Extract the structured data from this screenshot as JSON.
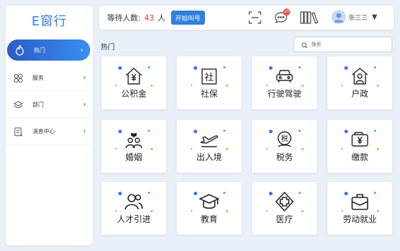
{
  "brand": "E窗行",
  "sidebar": {
    "items": [
      {
        "label": "热门",
        "icon": "fire-icon",
        "active": true
      },
      {
        "label": "服务",
        "icon": "services-icon",
        "active": false
      },
      {
        "label": "部门",
        "icon": "layers-icon",
        "active": false
      },
      {
        "label": "消息中心",
        "icon": "message-center-icon",
        "active": false
      }
    ]
  },
  "header": {
    "wait_label": "等待人数:",
    "wait_count": "43",
    "wait_unit": "人",
    "call_button": "开始叫号",
    "notification_count": "10",
    "user_name": "张三三"
  },
  "main": {
    "section_title": "热门",
    "search_placeholder": "搜索",
    "services": [
      {
        "label": "公积金",
        "icon": "housing-fund-icon"
      },
      {
        "label": "社保",
        "icon": "social-security-icon"
      },
      {
        "label": "行驶驾驶",
        "icon": "car-icon"
      },
      {
        "label": "户政",
        "icon": "household-icon"
      },
      {
        "label": "婚姻",
        "icon": "marriage-icon"
      },
      {
        "label": "出入境",
        "icon": "airplane-icon"
      },
      {
        "label": "税务",
        "icon": "tax-icon"
      },
      {
        "label": "缴款",
        "icon": "payment-icon"
      },
      {
        "label": "人才引进",
        "icon": "talent-icon"
      },
      {
        "label": "教育",
        "icon": "education-icon"
      },
      {
        "label": "医疗",
        "icon": "medical-icon"
      },
      {
        "label": "劳动就业",
        "icon": "employment-icon"
      }
    ]
  },
  "colors": {
    "accent": "#2f7fe0",
    "count_red": "#e0394c",
    "dot_blue": "#3b6ef0",
    "dot_green": "#3cc46a",
    "dot_orange": "#f0a04a",
    "dot_pink": "#e36ad0"
  }
}
